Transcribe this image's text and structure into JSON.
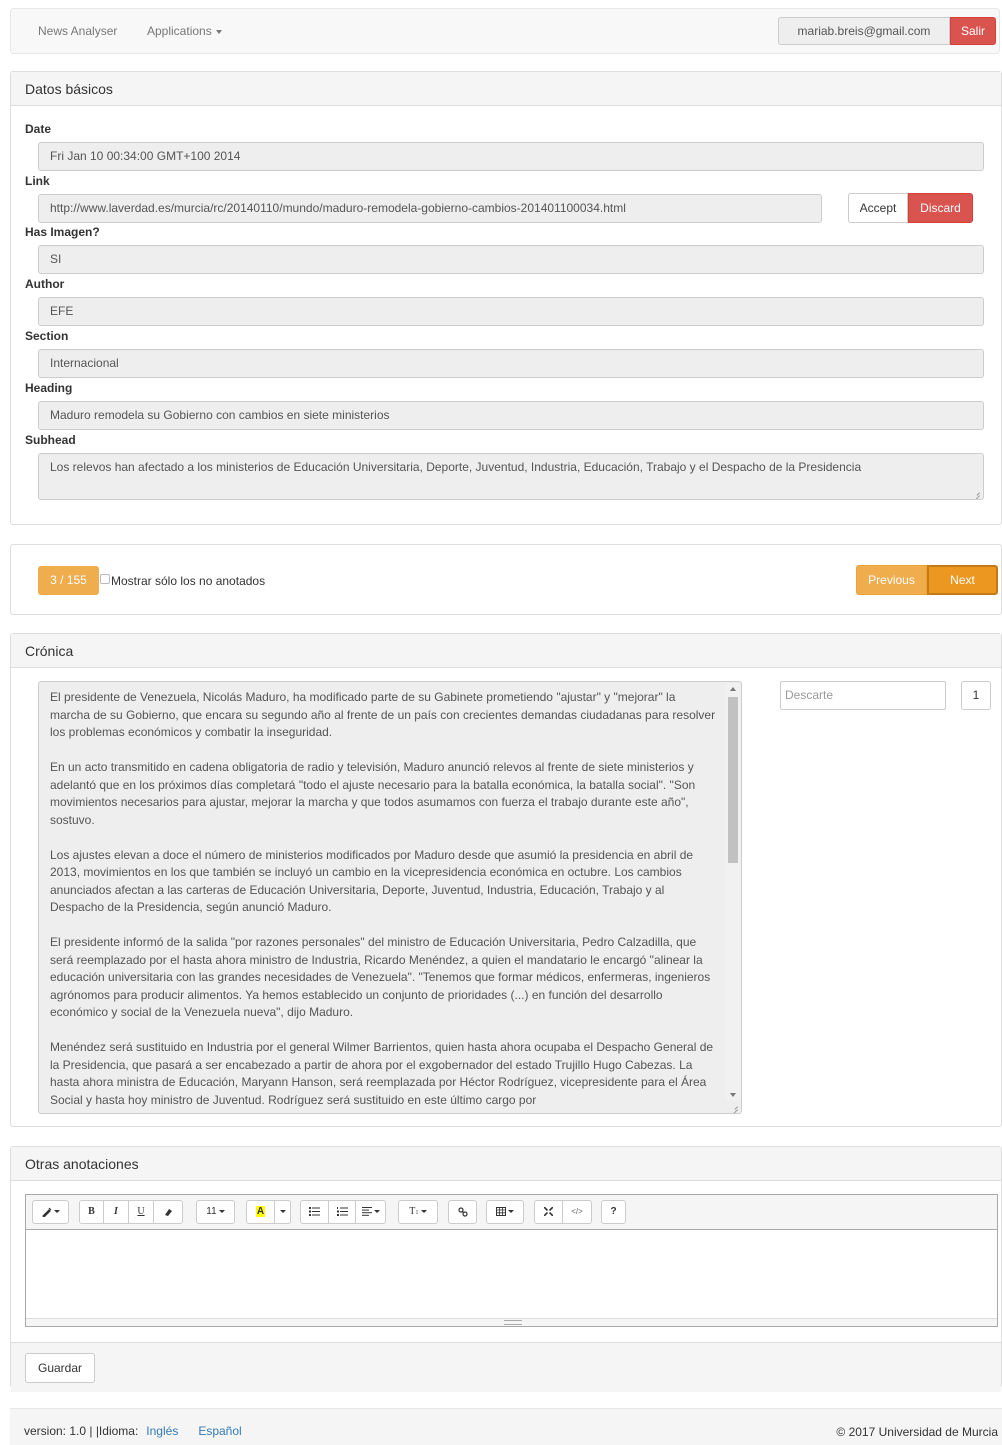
{
  "navbar": {
    "brand": "News Analyser",
    "applications": "Applications",
    "email": "mariab.breis@gmail.com",
    "salir": "Salir"
  },
  "datos": {
    "title": "Datos básicos",
    "fields": {
      "date": {
        "label": "Date",
        "value": "Fri Jan 10 00:34:00 GMT+100 2014"
      },
      "link": {
        "label": "Link",
        "value": "http://www.laverdad.es/murcia/rc/20140110/mundo/maduro-remodela-gobierno-cambios-201401100034.html"
      },
      "has_imagen": {
        "label": "Has Imagen?",
        "value": "SI"
      },
      "author": {
        "label": "Author",
        "value": "EFE"
      },
      "section": {
        "label": "Section",
        "value": "Internacional"
      },
      "heading": {
        "label": "Heading",
        "value": "Maduro remodela su Gobierno con cambios en siete ministerios"
      },
      "subhead": {
        "label": "Subhead",
        "value": "Los relevos han afectado a los ministerios de Educación Universitaria, Deporte, Juventud, Industria, Educación, Trabajo y el Despacho de la Presidencia"
      }
    },
    "accept": "Accept",
    "discard": "Discard"
  },
  "pager": {
    "counter": "3 / 155",
    "checkbox_label": "Mostrar sólo los no anotados",
    "previous": "Previous",
    "next": "Next"
  },
  "cronica": {
    "title": "Crónica",
    "paragraphs": [
      "El presidente de Venezuela, Nicolás Maduro, ha modificado parte de su Gabinete prometiendo \"ajustar\" y \"mejorar\" la marcha de su Gobierno, que encara su segundo año al frente de un país con crecientes demandas ciudadanas para resolver los problemas económicos y combatir la inseguridad.",
      "En un acto transmitido en cadena obligatoria de radio y televisión, Maduro anunció relevos al frente de siete ministerios y adelantó que en los próximos días completará \"todo el ajuste necesario para la batalla económica, la batalla social\". \"Son movimientos necesarios para ajustar, mejorar la marcha y que todos asumamos con fuerza el trabajo durante este año\", sostuvo.",
      "Los ajustes elevan a doce el número de ministerios modificados por Maduro desde que asumió la presidencia en abril de 2013, movimientos en los que también se incluyó un cambio en la vicepresidencia económica en octubre. Los cambios anunciados afectan a las carteras de Educación Universitaria, Deporte, Juventud, Industria, Educación, Trabajo y al Despacho de la Presidencia, según anunció Maduro.",
      "El presidente informó de la salida \"por razones personales\" del ministro de Educación Universitaria, Pedro Calzadilla, que será reemplazado por el hasta ahora ministro de Industria, Ricardo Menéndez, a quien el mandatario le encargó \"alinear la educación universitaria con las grandes necesidades de Venezuela\". \"Tenemos que formar médicos, enfermeras, ingenieros agrónomos para producir alimentos. Ya hemos establecido un conjunto de prioridades (...) en función del desarrollo económico y social de la Venezuela nueva\", dijo Maduro.",
      "Menéndez será sustituido en Industria por el general Wilmer Barrientos, quien hasta ahora ocupaba el Despacho General de la Presidencia, que pasará a ser encabezado a partir de ahora por el exgobernador del estado Trujillo Hugo Cabezas. La hasta ahora ministra de Educación, Maryann Hanson, será reemplazada por Héctor Rodríguez, vicepresidente para el Área Social y hasta hoy ministro de Juventud. Rodríguez será sustituido en este último cargo por"
    ],
    "descarte_placeholder": "Descarte",
    "descarte_count": "1"
  },
  "otras": {
    "title": "Otras anotaciones",
    "toolbar": {
      "bold": "B",
      "italic": "I",
      "underline": "U",
      "font_size": "11",
      "highlight": "A",
      "style": "T",
      "help": "?"
    },
    "guardar": "Guardar"
  },
  "footer": {
    "version": "version: 1.0 | |Idioma:",
    "lang_en": "Inglés",
    "lang_es": "Español",
    "copyright": "© 2017 Universidad de Murcia"
  },
  "colors": {
    "danger": "#d9534f",
    "warning": "#f0ad4e",
    "link": "#337ab7"
  },
  "icons": [
    "magic-pen-icon",
    "eraser-icon",
    "unordered-list-icon",
    "ordered-list-icon",
    "align-icon",
    "link-icon",
    "table-icon",
    "fullscreen-icon",
    "code-view-icon",
    "resize-grip-icon"
  ]
}
